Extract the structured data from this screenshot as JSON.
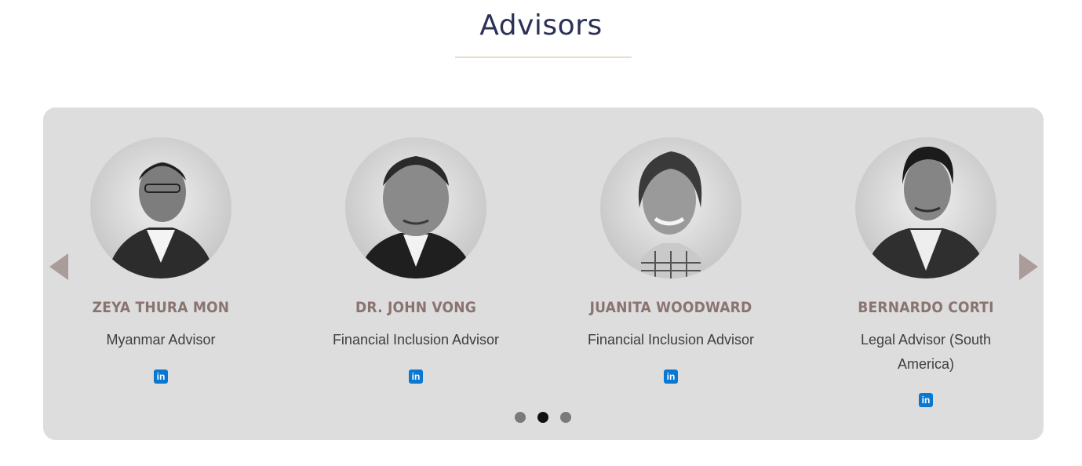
{
  "section": {
    "title": "Advisors"
  },
  "carousel": {
    "prev_icon": "triangle-left-icon",
    "next_icon": "triangle-right-icon",
    "active_dot_index": 1,
    "dot_count": 3,
    "advisors": [
      {
        "name": "ZEYA THURA MON",
        "role": "Myanmar Advisor",
        "social_icon": "linkedin-icon",
        "social_label": "in"
      },
      {
        "name": "DR. JOHN VONG",
        "role": "Financial Inclusion Advisor",
        "social_icon": "linkedin-icon",
        "social_label": "in"
      },
      {
        "name": "JUANITA WOODWARD",
        "role": "Financial Inclusion Advisor",
        "social_icon": "linkedin-icon",
        "social_label": "in"
      },
      {
        "name": "BERNARDO CORTI",
        "role": "Legal Advisor (South America)",
        "social_icon": "linkedin-icon",
        "social_label": "in"
      }
    ]
  },
  "colors": {
    "title": "#2b3157",
    "underline": "#e8dfc6",
    "panel_bg": "#dddddd",
    "name": "#8a7470",
    "arrow": "#a99c99",
    "linkedin": "#0a78d1",
    "dot_active": "#111111",
    "dot_inactive": "#7a7a7a"
  }
}
